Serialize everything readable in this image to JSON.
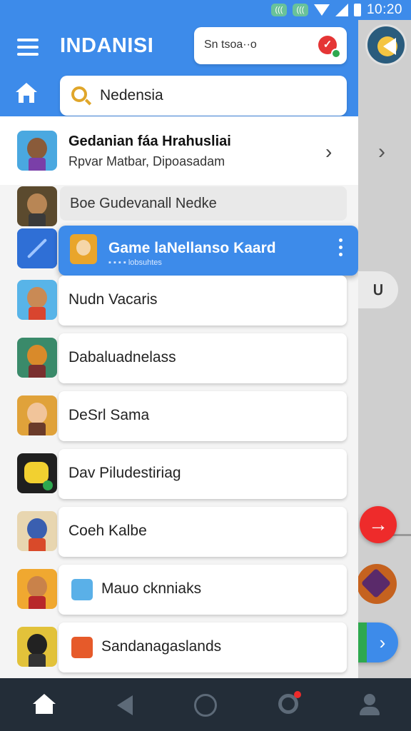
{
  "status_bar": {
    "chip_1": "(((",
    "chip_2": "(((",
    "time": "10:20"
  },
  "header": {
    "title": "INDANISI",
    "chip_text": "Sn tsoa··o",
    "chip_badge": "✓"
  },
  "search": {
    "value": "Nedensia"
  },
  "featured": {
    "title": "Gedanian fáa Hrahusliai",
    "subtitle": "Rpvar Matbar, Dipoasadam",
    "chevron": "›"
  },
  "plain_row": {
    "label": "Boe Gudevanall Nedke"
  },
  "highlight": {
    "title": "Game laNellanso Kaard",
    "subtitle": "▪ ▪ ▪ ▪   lobsuhtes"
  },
  "list": [
    {
      "label": "Nudn Vacaris",
      "thumb_icon": "warrior-avatar-icon"
    },
    {
      "label": "Dabaluadnelass",
      "thumb_icon": "dragon-game-icon"
    },
    {
      "label": "DeSrl Sama",
      "thumb_icon": "heroine-avatar-icon"
    },
    {
      "label": "Dav Piludestiriag",
      "thumb_icon": "lego-head-icon"
    },
    {
      "label": "Coeh Kalbe",
      "thumb_icon": "wizard-avatar-icon"
    },
    {
      "label": "Mauo cknniaks",
      "thumb_icon": "character-avatar-icon"
    },
    {
      "label": "Sandanagaslands",
      "thumb_icon": "ninja-avatar-icon"
    }
  ],
  "right_panel": {
    "chevron": "›",
    "pill_icon": "ᑌ",
    "fab_arrow": "→",
    "fab_green": "!",
    "fab_blue": "›"
  },
  "colors": {
    "primary": "#3d8bea",
    "danger": "#ee2b2b",
    "success": "#2ea84f",
    "nav_bg": "#232d38"
  }
}
